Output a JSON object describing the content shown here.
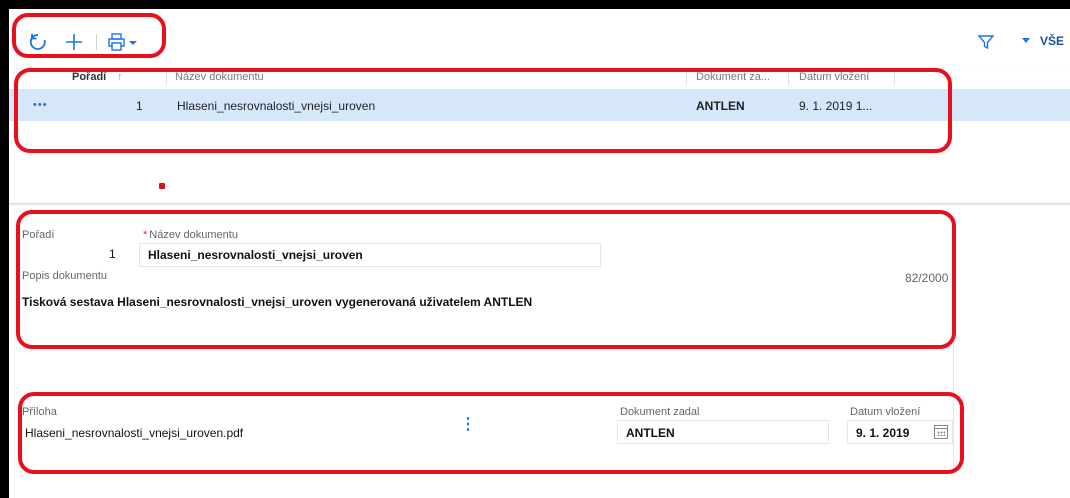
{
  "toolbar": {
    "icons": [
      "refresh-icon",
      "add-icon",
      "print-icon",
      "filter-icon"
    ],
    "filter_label": "VŠE"
  },
  "grid": {
    "columns": [
      "Pořadí",
      "Název dokumentu",
      "Dokument za...",
      "Datum vložení"
    ],
    "rows": [
      {
        "more": "•••",
        "poradi": "1",
        "nazev": "Hlaseni_nesrovnalosti_vnejsi_uroven",
        "zadal": "ANTLEN",
        "datum": "9. 1. 2019 1..."
      }
    ]
  },
  "form": {
    "poradi_label": "Pořadí",
    "poradi_value": "1",
    "nazev_required": "*",
    "nazev_label": "Název dokumentu",
    "nazev_value": "Hlaseni_nesrovnalosti_vnejsi_uroven",
    "popis_label": "Popis dokumentu",
    "popis_counter": "82/2000",
    "popis_value": "Tisková sestava Hlaseni_nesrovnalosti_vnejsi_uroven vygenerovaná uživatelem ANTLEN",
    "priloha_label": "Příloha",
    "priloha_value": "Hlaseni_nesrovnalosti_vnejsi_uroven.pdf",
    "zadal_label": "Dokument zadal",
    "zadal_value": "ANTLEN",
    "datum_label": "Datum vložení",
    "datum_value": "9. 1. 2019"
  },
  "colors": {
    "accent": "#1a73e8",
    "selected_row": "#d6e6fb",
    "highlight_annotation": "#e8101d"
  }
}
